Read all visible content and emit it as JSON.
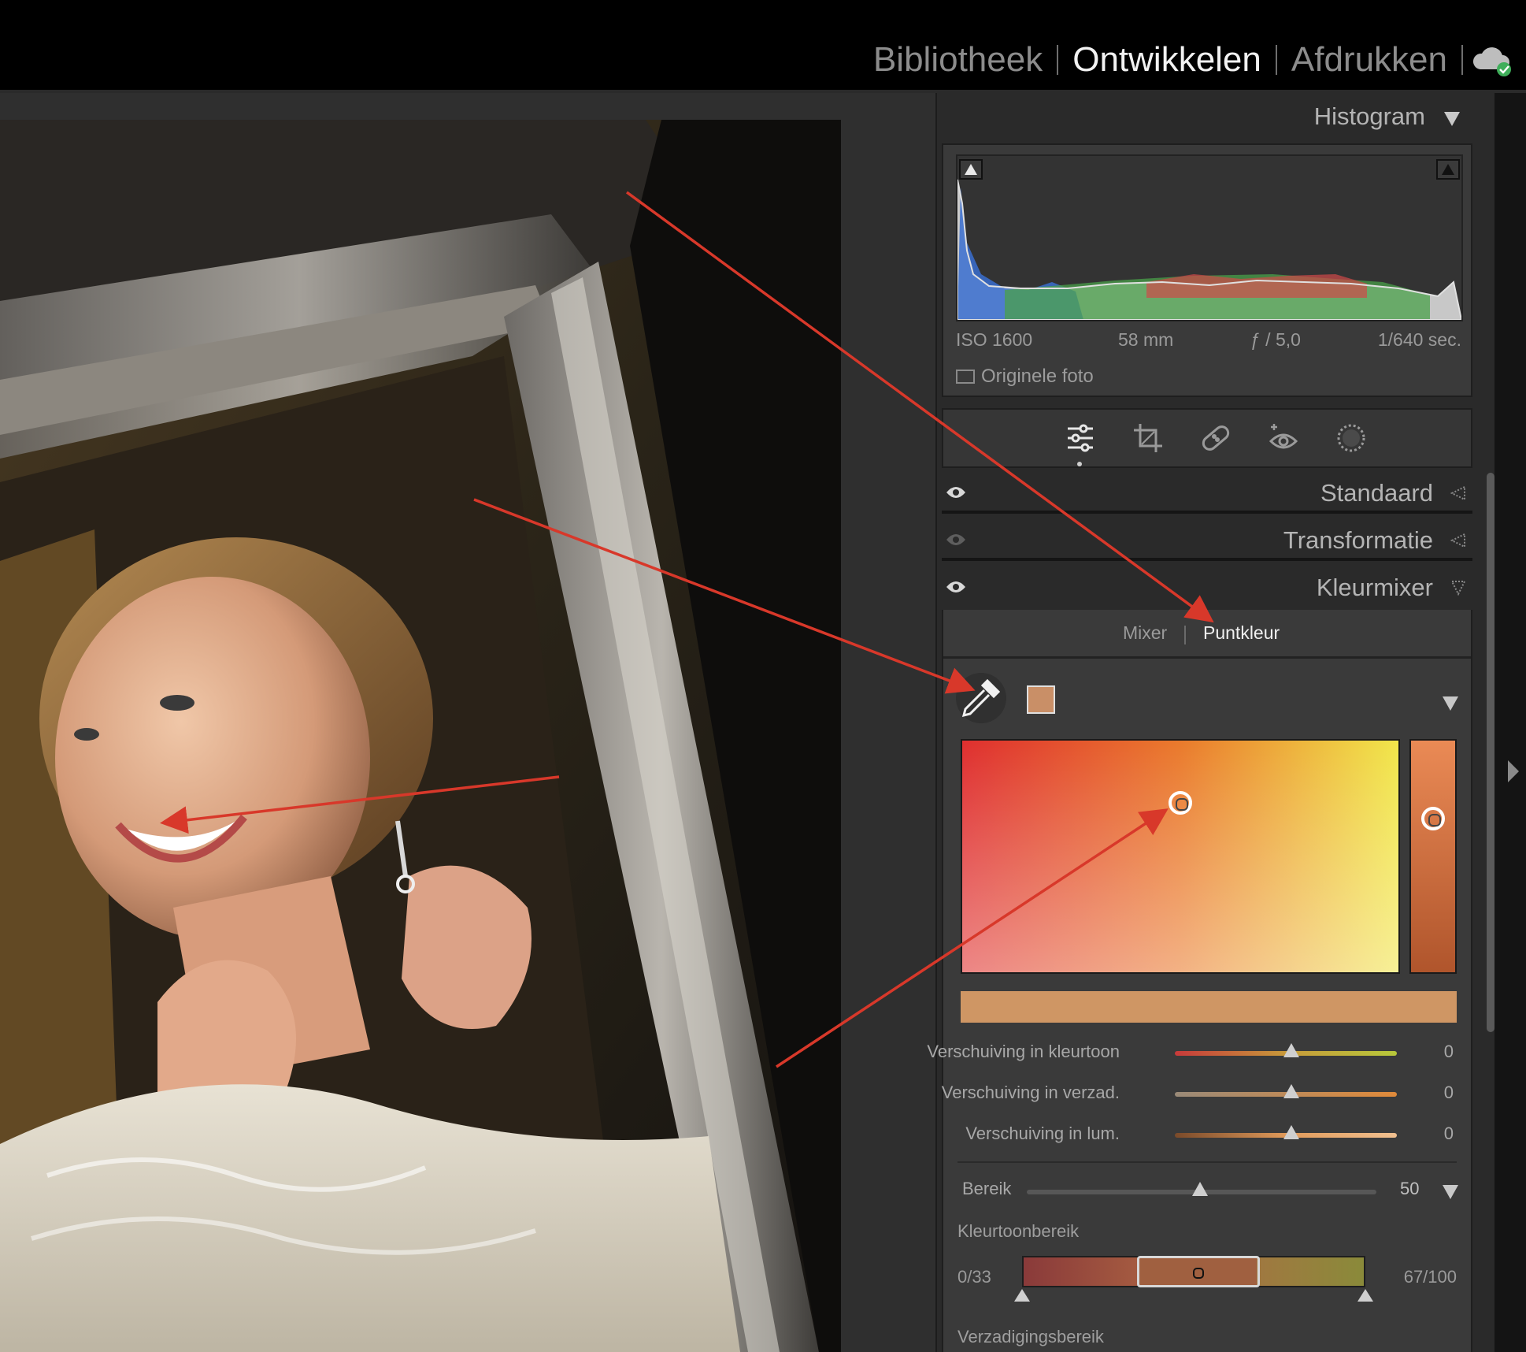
{
  "modules": [
    {
      "label": "Bibliotheek",
      "active": false
    },
    {
      "label": "Ontwikkelen",
      "active": true
    },
    {
      "label": "Afdrukken",
      "active": false
    }
  ],
  "cloud_icon": "cloud-synced-icon",
  "histogram": {
    "title": "Histogram",
    "iso": "ISO 1600",
    "focal": "58 mm",
    "aperture": "ƒ / 5,0",
    "shutter": "1/640 sec.",
    "original_photo": "Originele foto"
  },
  "tools": [
    "edit-sliders-icon",
    "crop-icon",
    "healing-icon",
    "red-eye-icon",
    "mask-icon"
  ],
  "sections": {
    "standaard": "Standaard",
    "transformatie": "Transformatie",
    "kleurmixer": "Kleurmixer"
  },
  "colormixer": {
    "tabs": {
      "mixer": "Mixer",
      "puntkleur": "Puntkleur"
    },
    "swatch_color": "#c98f67",
    "sample_color": "#cf9664",
    "sliders": [
      {
        "label": "Verschuiving in kleurtoon",
        "value": "0"
      },
      {
        "label": "Verschuiving in verzad.",
        "value": "0"
      },
      {
        "label": "Verschuiving in lum.",
        "value": "0"
      }
    ],
    "bereik": {
      "label": "Bereik",
      "value": "50"
    },
    "kleurtoonbereik": {
      "label": "Kleurtoonbereik",
      "min": "0/33",
      "max": "67/100"
    },
    "verzadigingsbereik": {
      "label": "Verzadigingsbereik"
    }
  },
  "colors": {
    "accent_arrow": "#d8382a",
    "panel_bg": "#2a2a2a"
  }
}
